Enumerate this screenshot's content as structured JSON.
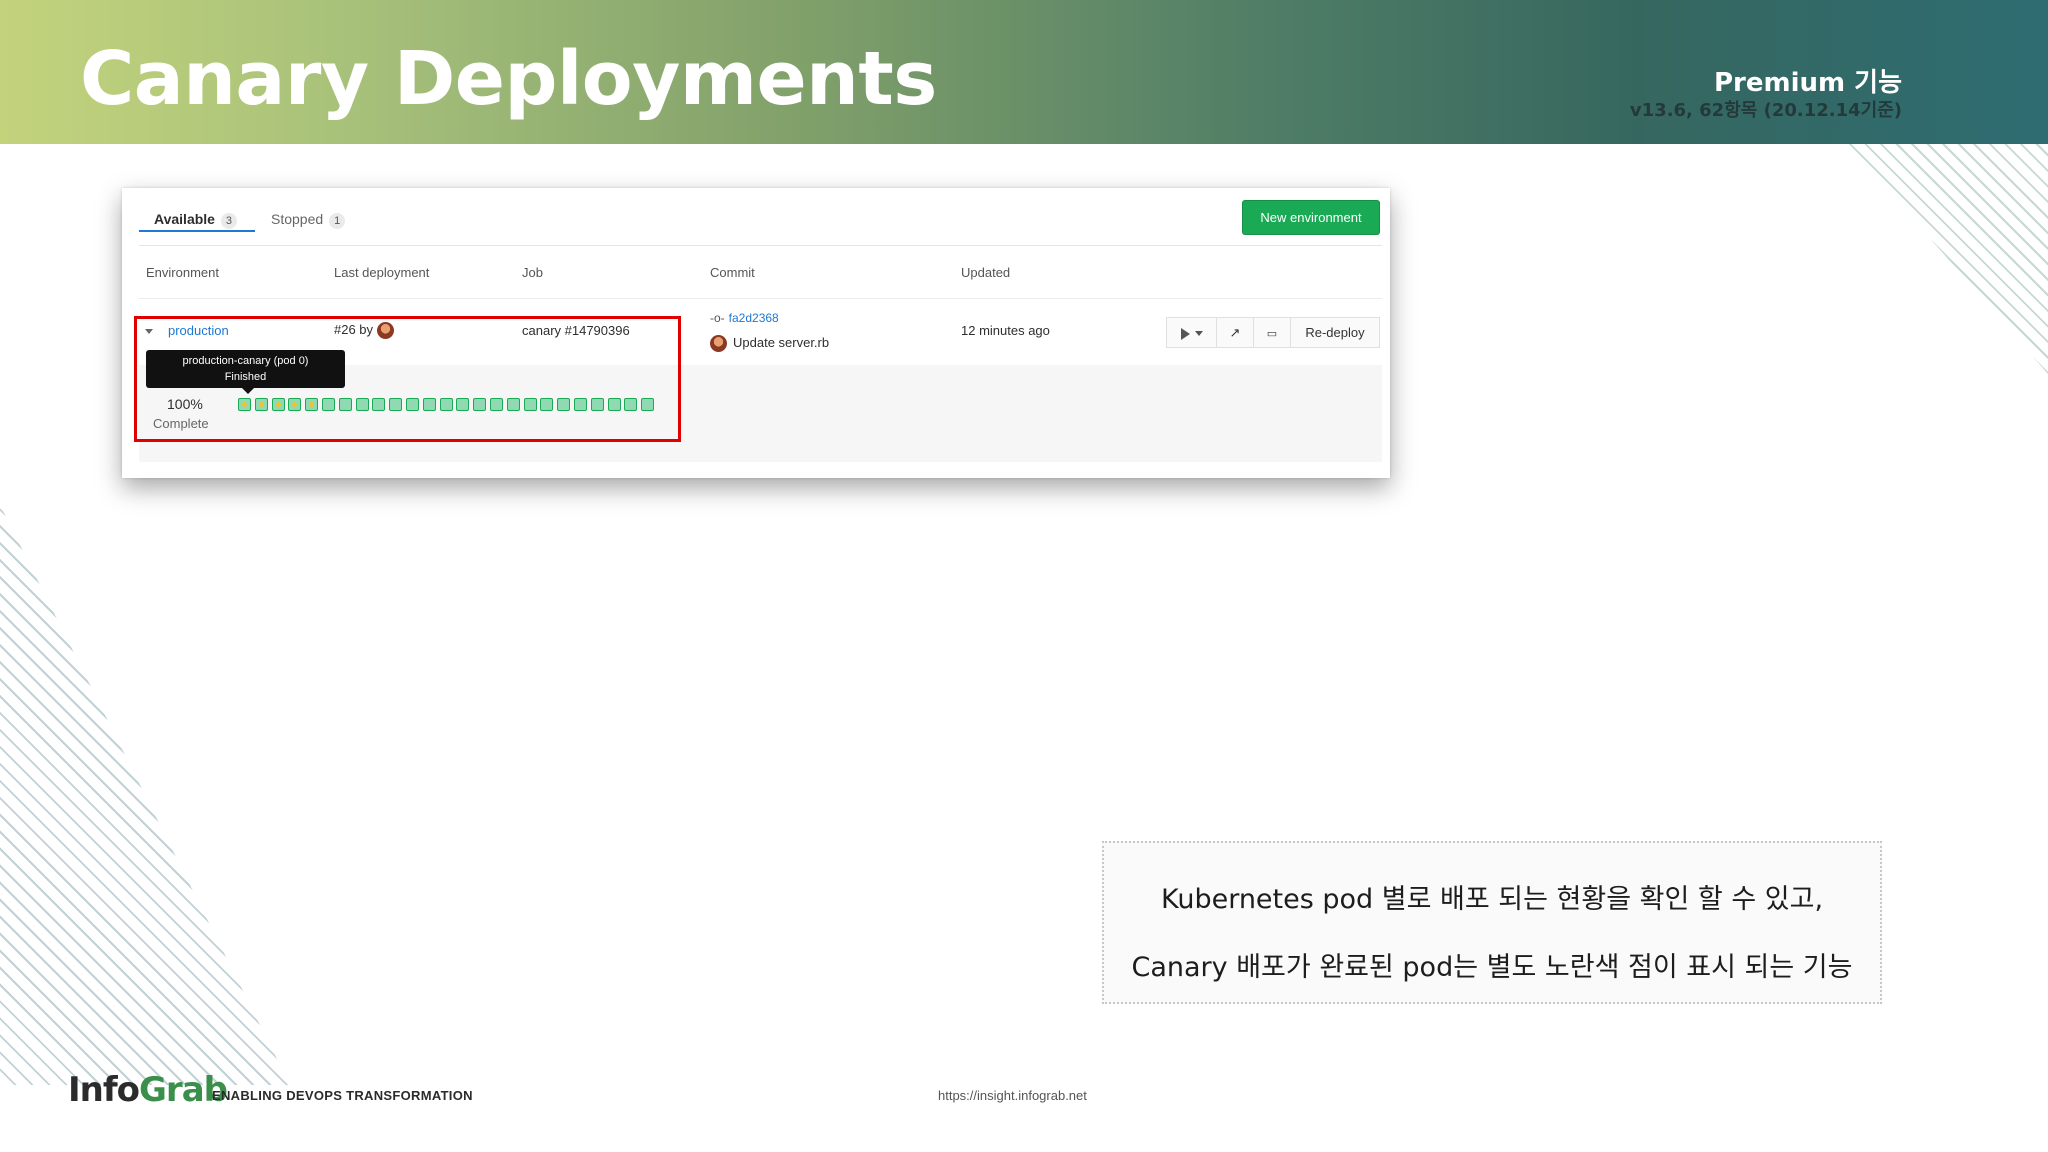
{
  "header": {
    "title": "Canary Deployments",
    "badge": "Premium 기능",
    "version": "v13.6, 62항목 (20.12.14기준)"
  },
  "screenshot": {
    "tabs": [
      {
        "label": "Available",
        "count": "3"
      },
      {
        "label": "Stopped",
        "count": "1"
      }
    ],
    "new_environment_label": "New environment",
    "columns": [
      "Environment",
      "Last deployment",
      "Job",
      "Commit",
      "Updated"
    ],
    "row": {
      "environment": "production",
      "last_deployment": "#26 by",
      "job": "canary #14790396",
      "commit_sha": "fa2d2368",
      "commit_message": "Update server.rb",
      "updated": "12 minutes ago",
      "redeploy_label": "Re-deploy"
    },
    "tooltip": {
      "line1": "production-canary (pod 0)",
      "line2": "Finished"
    },
    "progress": {
      "percent_label": "100%",
      "status_label": "Complete",
      "pod_count": 25,
      "canary_pods": 5
    }
  },
  "description": {
    "line1": "Kubernetes pod 별로 배포 되는 현황을 확인 할 수 있고,",
    "line2": "Canary 배포가 완료된 pod는 별도 노란색 점이 표시 되는 기능"
  },
  "footer": {
    "logo_part1": "Info",
    "logo_part2": "Grab",
    "tagline": "ENABLING DEVOPS TRANSFORMATION",
    "url": "https://insight.infograb.net"
  },
  "colors": {
    "accent_green": "#1aaa55",
    "link_blue": "#1f78d1",
    "highlight_red": "#e00000",
    "canary_dot": "#f0c431"
  }
}
